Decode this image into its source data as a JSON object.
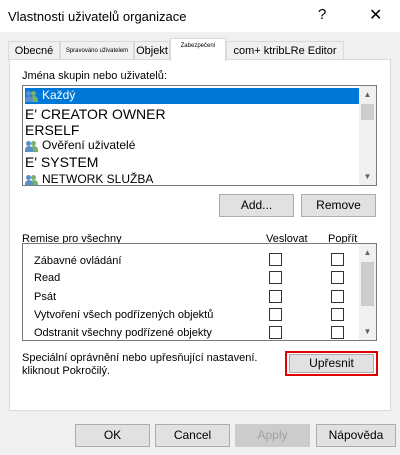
{
  "window": {
    "title": "Vlastnosti uživatelů organizace",
    "help_glyph": "?",
    "close_glyph": "✕"
  },
  "tabs": [
    {
      "label": "Obecné"
    },
    {
      "label": "Spravováno uživatelem"
    },
    {
      "label": "Objekt"
    },
    {
      "label": "Zabezpečení"
    },
    {
      "label": "com+ ktribLRe Editor"
    }
  ],
  "groups": {
    "label": "Jména skupin nebo uživatelů:",
    "items": [
      {
        "label": "Každý",
        "icon": "users-icon",
        "selected": true
      },
      {
        "label": "E' CREATOR OWNER",
        "icon": "none"
      },
      {
        "label": "ERSELF",
        "icon": "none"
      },
      {
        "label": "Ověření uživatelé",
        "icon": "users-icon"
      },
      {
        "label": "E' SYSTEM",
        "icon": "none"
      },
      {
        "label": "NETWORK SLUŽBA",
        "icon": "users-icon"
      }
    ]
  },
  "buttons": {
    "add": "Add...",
    "remove": "Remove",
    "ok": "OK",
    "cancel": "Cancel",
    "apply": "Apply",
    "help": "Nápověda",
    "advanced": "Upřesnit"
  },
  "permissions": {
    "header": "Remise pro všechny",
    "allow_header": "Veslovat",
    "deny_header": "Popřít",
    "rows": [
      {
        "label": "Zábavné ovládání"
      },
      {
        "label": "Read"
      },
      {
        "label": "Psát"
      },
      {
        "label": "Vytvoření všech podřízených objektů"
      },
      {
        "label": "Odstranit všechny podřízené objekty"
      }
    ]
  },
  "advanced_note": "Speciální oprávnění nebo upřesňující nastavení. kliknout Pokročilý.",
  "colors": {
    "highlight": "#e00000",
    "selection": "#0078d7"
  }
}
